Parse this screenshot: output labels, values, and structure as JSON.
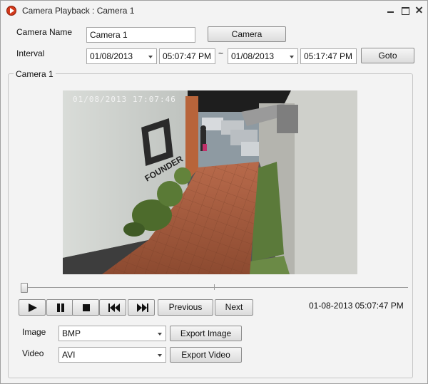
{
  "window": {
    "title": "Camera Playback : Camera 1"
  },
  "form": {
    "camera_name_label": "Camera Name",
    "camera_name_value": "Camera 1",
    "camera_button": "Camera",
    "interval_label": "Interval",
    "from_date": "01/08/2013",
    "from_time": "05:07:47 PM",
    "range_separator": "~",
    "to_date": "01/08/2013",
    "to_time": "05:17:47 PM",
    "goto_button": "Goto"
  },
  "group": {
    "title": "Camera 1",
    "video_osd": "01/08/2013  17:07:46",
    "video_logo_text": "FOUNDER"
  },
  "playback": {
    "position_fraction": 0.0,
    "previous_label": "Previous",
    "next_label": "Next",
    "current_time": "01-08-2013 05:07:47 PM",
    "controls": [
      "play-icon",
      "pause-icon",
      "stop-icon",
      "skip-back-icon",
      "skip-forward-icon"
    ]
  },
  "export": {
    "image_label": "Image",
    "image_format": "BMP",
    "export_image_button": "Export Image",
    "video_label": "Video",
    "video_format": "AVI",
    "export_video_button": "Export Video"
  }
}
